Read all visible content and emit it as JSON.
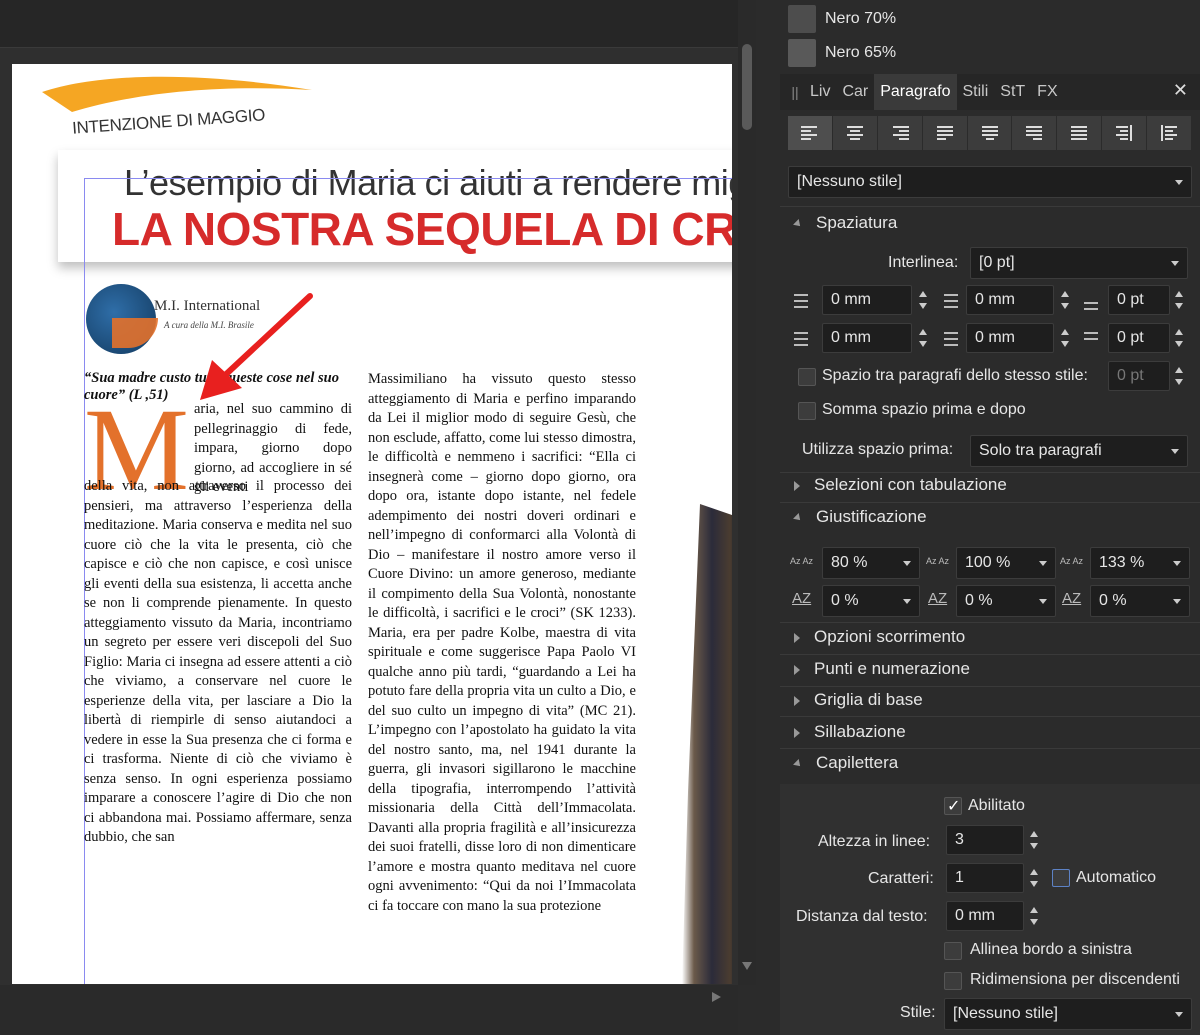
{
  "swatches": [
    {
      "name": "Nero 70%",
      "color": "#4d4d4d"
    },
    {
      "name": "Nero 65%",
      "color": "#595959"
    }
  ],
  "tabs": [
    {
      "label": "Liv"
    },
    {
      "label": "Car"
    },
    {
      "label": "Paragrafo",
      "active": true
    },
    {
      "label": "Stili"
    },
    {
      "label": "StT"
    },
    {
      "label": "FX"
    }
  ],
  "paragraph_style": "[Nessuno stile]",
  "sections": {
    "spaziatura": "Spaziatura",
    "selezioni": "Selezioni con tabulazione",
    "giustificazione": "Giustificazione",
    "opzioni": "Opzioni scorrimento",
    "punti": "Punti e numerazione",
    "griglia": "Griglia di base",
    "sillabazione": "Sillabazione",
    "capilettera": "Capilettera"
  },
  "spacing": {
    "interlinea_label": "Interlinea:",
    "interlinea_value": "[0 pt]",
    "left_indent": "0 mm",
    "first_indent": "0 mm",
    "space_before": "0 pt",
    "right_indent": "0 mm",
    "last_indent": "0 mm",
    "space_after": "0 pt",
    "same_style_label": "Spazio tra paragrafi dello stesso stile:",
    "same_style_value": "0 pt",
    "sum_label": "Somma spazio prima e dopo",
    "use_before_label": "Utilizza spazio prima:",
    "use_before_value": "Solo tra paragrafi"
  },
  "justification": {
    "word_min": "80 %",
    "word_desired": "100 %",
    "word_max": "133 %",
    "letter_min": "0 %",
    "letter_desired": "0 %",
    "letter_max": "0 %"
  },
  "dropcap": {
    "enabled_label": "Abilitato",
    "height_label": "Altezza in linee:",
    "height_value": "3",
    "chars_label": "Caratteri:",
    "chars_value": "1",
    "auto_label": "Automatico",
    "distance_label": "Distanza dal testo:",
    "distance_value": "0 mm",
    "align_left_label": "Allinea bordo a sinistra",
    "resize_label": "Ridimensiona per discendenti",
    "style_label": "Stile:",
    "style_value": "[Nessuno stile]"
  },
  "document": {
    "kicker": "INTENZIONE DI MAGGIO",
    "headline_1": "L’esempio di Maria ci aiuti a rendere mig",
    "headline_2": "LA NOSTRA SEQUELA DI CRIS",
    "logo_title": "M.I. International",
    "logo_sub": "A cura della M.I. Brasile",
    "quote": "“Sua madre custo    tutte queste cose nel suo cuore” (L    ,51)",
    "dropcap_letter": "M",
    "col1_top": "aria, nel suo cammino di pellegrinaggio di fede, impara, giorno dopo giorno, ad accogliere in sé gli eventi",
    "col1": "della vita, non attraverso il processo dei pensieri, ma attraverso l’esperienza della meditazione. Maria conserva e medita nel suo cuore ciò che la vita le presenta, ciò che capisce e ciò che non capisce, e così unisce gli eventi della sua esistenza, li accetta anche se non li comprende pienamente. In questo atteggiamento vissuto da Maria, incontriamo un segreto per essere veri discepoli del Suo Figlio: Maria ci insegna ad essere attenti a ciò che viviamo, a conservare nel cuore le esperienze della vita, per lasciare a Dio la libertà di riempirle di senso aiutandoci a vedere in esse la Sua presenza che ci forma e ci trasforma. Niente di ciò che viviamo è senza senso. In ogni esperienza possiamo imparare a conoscere l’agire di Dio che non ci abbandona mai. Possiamo affermare, senza dubbio, che san",
    "col2": "Massimiliano ha vissuto questo stesso atteggiamento di Maria e perfino imparando da Lei il miglior modo di seguire Gesù, che non esclude, affatto, come lui stesso dimostra, le difficoltà e nemmeno i sacrifici: “Ella ci insegnerà come – giorno dopo giorno, ora dopo ora, istante dopo istante, nel fedele adempimento dei nostri doveri ordinari e nell’impegno di conformarci alla Volontà di Dio – manifestare il nostro amore verso il Cuore Divino: un amore generoso, mediante il compimento della Sua Volontà, nonostante le difficoltà, i sacrifici e le croci” (SK 1233). Maria, era per padre Kolbe, maestra di vita spirituale e come suggerisce Papa Paolo VI qualche anno più tardi, “guardando a Lei ha potuto fare della propria vita un culto a Dio, e del suo culto un impegno di vita” (MC 21). L’impegno con l’apostolato ha guidato la vita del nostro santo, ma, nel 1941 durante la guerra, gli invasori sigillarono le macchine della tipografia, interrompendo l’attività missionaria della Città dell’Immacolata. Davanti alla propria fragilità e all’insicurezza dei suoi fratelli, disse loro di non dimenticare l’amore e mostra quanto meditava nel cuore ogni avvenimento: “Qui da noi l’Immacolata ci fa toccare con mano la sua protezione"
  },
  "colors": {
    "accent_orange": "#e3712b",
    "headline_red": "#d62b2b",
    "arrow_red": "#e8201f"
  }
}
